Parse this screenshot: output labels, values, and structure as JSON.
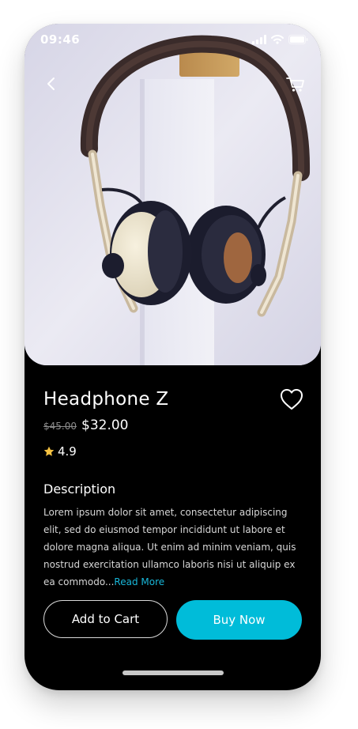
{
  "status_bar": {
    "time": "09:46",
    "icons": [
      "signal-icon",
      "wifi-icon",
      "battery-icon"
    ]
  },
  "nav": {
    "back_icon": "chevron-left-icon",
    "cart_icon": "cart-icon"
  },
  "product": {
    "name": "Headphone Z",
    "old_price": "$45.00",
    "price": "$32.00",
    "rating": "4.9",
    "rating_icon": "star-icon",
    "wishlist_icon": "heart-icon",
    "image": "headphones-photo"
  },
  "description": {
    "heading": "Description",
    "text": "Lorem ipsum dolor sit amet, consectetur adipiscing elit, sed do eiusmod tempor incididunt ut labore et dolore magna aliqua. Ut enim ad minim veniam, quis nostrud exercitation ullamco laboris nisi ut aliquip ex ea commodo...",
    "read_more": "Read More"
  },
  "actions": {
    "add_to_cart": "Add to Cart",
    "buy_now": "Buy Now"
  },
  "colors": {
    "accent": "#00bcd9",
    "background": "#000000",
    "star": "#f5c242",
    "text": "#ffffff"
  }
}
